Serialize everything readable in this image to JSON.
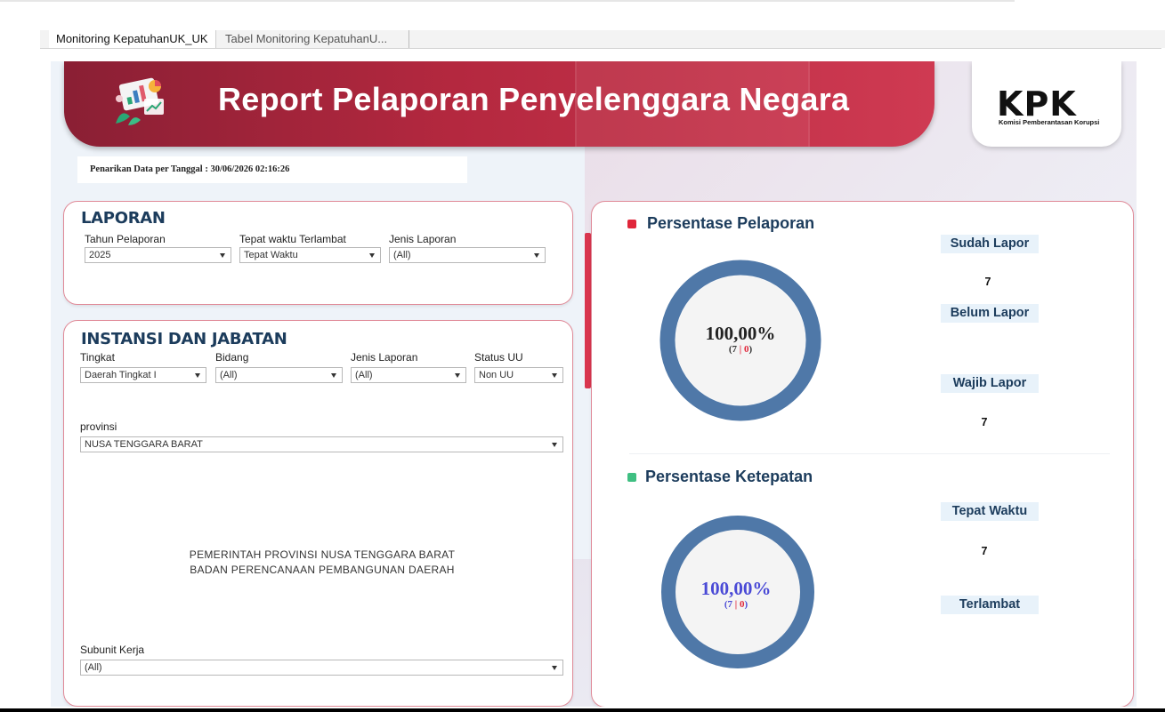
{
  "tabs": [
    {
      "label": "Monitoring KepatuhanUK_UK"
    },
    {
      "label": "Tabel Monitoring KepatuhanU..."
    }
  ],
  "banner": {
    "title": "Report Pelaporan Penyelenggara Negara",
    "logo": "KPK",
    "logo_sub": "Komisi Pemberantasan Korupsi"
  },
  "date_line": "Penarikan Data per Tanggal : 30/06/2026 02:16:26",
  "laporan": {
    "title": "LAPORAN",
    "filters": [
      {
        "label": "Tahun Pelaporan",
        "value": "2025"
      },
      {
        "label": "Tepat waktu Terlambat",
        "value": "Tepat Waktu"
      },
      {
        "label": "Jenis Laporan",
        "value": "(All)"
      }
    ]
  },
  "instansi": {
    "title": "INSTANSI DAN JABATAN",
    "filters": [
      {
        "label": "Tingkat",
        "value": "Daerah Tingkat I"
      },
      {
        "label": "Bidang",
        "value": "(All)"
      },
      {
        "label": "Jenis Laporan",
        "value": "(All)"
      },
      {
        "label": "Status UU",
        "value": "Non UU"
      }
    ],
    "provinsi": {
      "label": "provinsi",
      "value": "NUSA TENGGARA BARAT"
    },
    "unit_lines": [
      "PEMERINTAH PROVINSI NUSA TENGGARA BARAT",
      "BADAN PERENCANAAN PEMBANGUNAN DAERAH"
    ],
    "subunit": {
      "label": "Subunit Kerja",
      "value": "(All)"
    }
  },
  "pelaporan": {
    "title": "Persentase Pelaporan",
    "dot_color": "#e0263a",
    "percent": "100,00%",
    "fraction": 1.0,
    "count_left": "7",
    "count_right": "0",
    "ring_color": "#4f78a8",
    "metrics": [
      {
        "label": "Sudah Lapor",
        "value": "7"
      },
      {
        "label": "Belum Lapor",
        "value": ""
      },
      {
        "label": "Wajib Lapor",
        "value": "7"
      }
    ]
  },
  "ketepatan": {
    "title": "Persentase Ketepatan",
    "dot_color": "#3fbf82",
    "percent": "100,00%",
    "fraction": 1.0,
    "count_left": "7",
    "count_right": "0",
    "ring_color": "#4f78a8",
    "metrics": [
      {
        "label": "Tepat Waktu",
        "value": "7"
      },
      {
        "label": "Terlambat",
        "value": ""
      }
    ]
  }
}
